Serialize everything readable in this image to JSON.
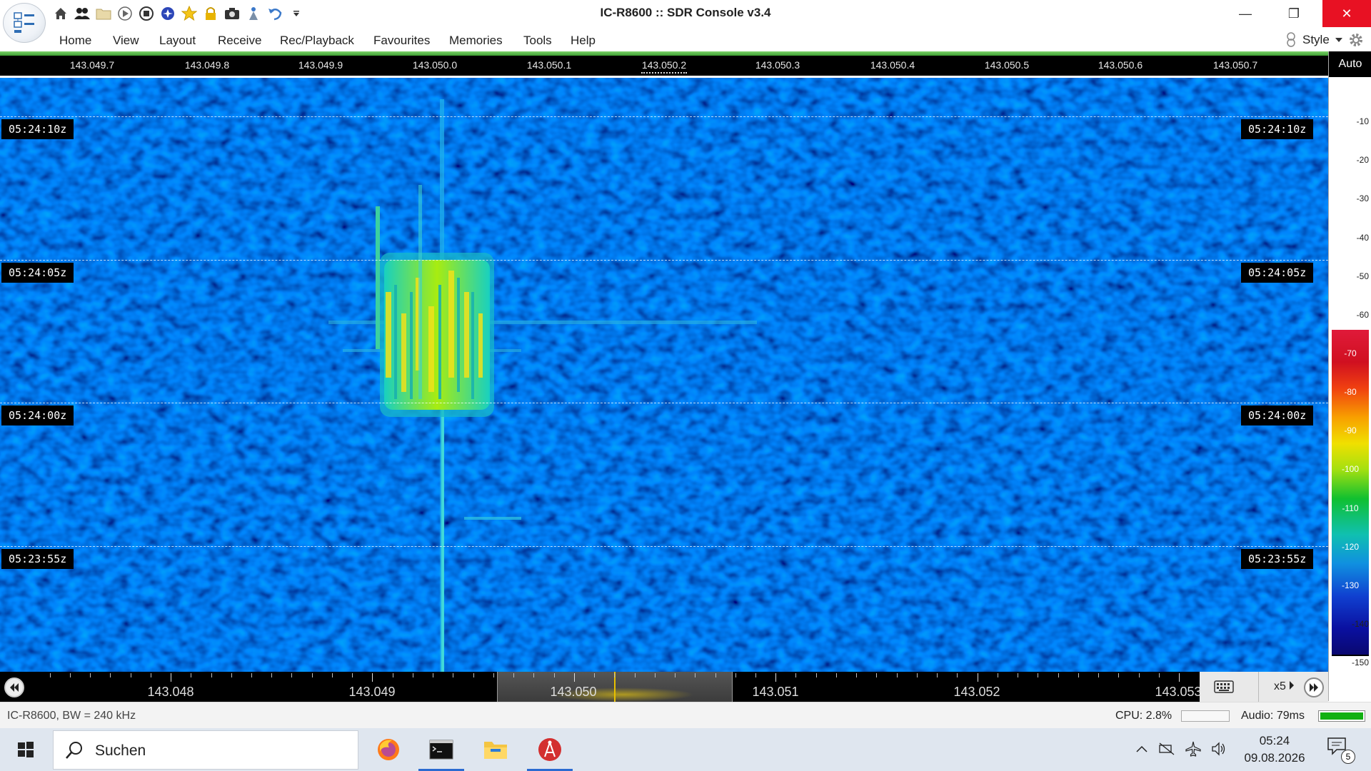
{
  "window": {
    "title": "IC-R8600 :: SDR Console v3.4",
    "controls": {
      "minimize": "—",
      "restore": "❐",
      "close": "✕"
    }
  },
  "quick_access": [
    "home-icon",
    "users-icon",
    "folder-icon",
    "play-icon",
    "stop-icon",
    "record-icon",
    "favourite-star-icon",
    "lock-icon",
    "camera-icon",
    "antenna-icon",
    "undo-icon",
    "customize-dropdown-icon"
  ],
  "menu": {
    "items": [
      "Home",
      "View",
      "Layout",
      "Receive",
      "Rec/Playback",
      "Favourites",
      "Memories",
      "Tools",
      "Help"
    ],
    "style_label": "Style"
  },
  "spectrum": {
    "freq_ticks": [
      "143.049.7",
      "143.049.8",
      "143.049.9",
      "143.050.0",
      "143.050.1",
      "143.050.2",
      "143.050.3",
      "143.050.4",
      "143.050.5",
      "143.050.6",
      "143.050.7"
    ]
  },
  "waterfall": {
    "time_marks": [
      "05:24:10z",
      "05:24:05z",
      "05:24:00z",
      "05:23:55z"
    ]
  },
  "db_scale": {
    "auto_label": "Auto",
    "labels": [
      "-10",
      "-20",
      "-30",
      "-40",
      "-50",
      "-60",
      "-70",
      "-80",
      "-90",
      "-100",
      "-110",
      "-120",
      "-130",
      "-140",
      "-150"
    ],
    "colors": {
      "top": "#e01a3a",
      "mid": "#f0e000",
      "low": "#10c030",
      "bottom": "#0a0870"
    }
  },
  "tuning": {
    "labels": [
      "143.048",
      "143.049",
      "143.050",
      "143.051",
      "143.052",
      "143.053"
    ],
    "zoom": "x5",
    "vfo_color": "#e8c000"
  },
  "status": {
    "radio": "IC-R8600, BW = 240 kHz",
    "cpu": "CPU: 2.8%",
    "audio": "Audio: 79ms",
    "audio_level": 1.0
  },
  "taskbar": {
    "search_placeholder": "Suchen",
    "time": "05:24",
    "date": "09.08.2026",
    "notification_count": "5",
    "apps": [
      "firefox-icon",
      "terminal-icon",
      "file-explorer-icon",
      "sdr-console-icon"
    ]
  }
}
